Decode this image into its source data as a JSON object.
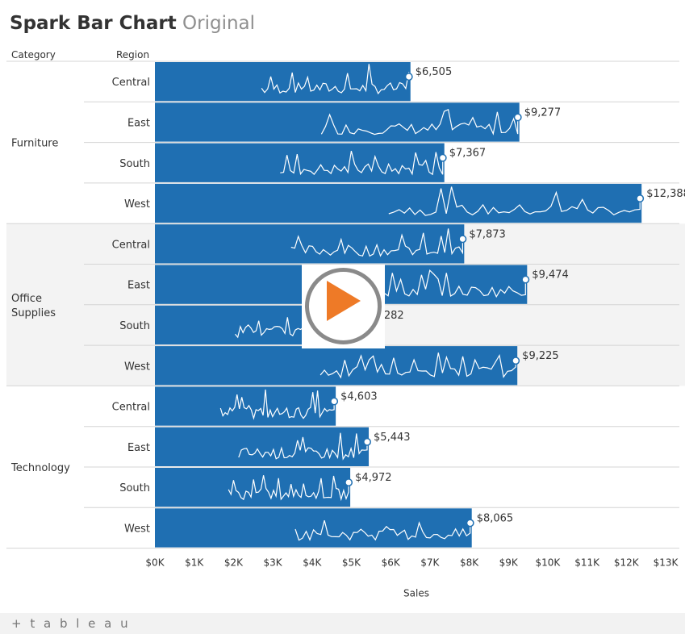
{
  "title": {
    "main": "Spark Bar Chart",
    "sub": "Original"
  },
  "headers": {
    "category": "Category",
    "region": "Region"
  },
  "footer": {
    "logo_text": "+ t a b l e a u"
  },
  "colors": {
    "bar": "#1f6fb2",
    "line": "#ffffff",
    "band": "#f3f3f3",
    "grid": "#d4d4d4"
  },
  "chart_data": {
    "type": "bar",
    "xlabel": "Sales",
    "ylabel": "",
    "xlim": [
      0,
      13000
    ],
    "x_ticks": [
      "$0K",
      "$1K",
      "$2K",
      "$3K",
      "$4K",
      "$5K",
      "$6K",
      "$7K",
      "$8K",
      "$9K",
      "$10K",
      "$11K",
      "$12K",
      "$13K"
    ],
    "categories": [
      {
        "name": "Furniture",
        "rows": [
          {
            "region": "Central",
            "value": 6505,
            "label": "$6,505"
          },
          {
            "region": "East",
            "value": 9277,
            "label": "$9,277"
          },
          {
            "region": "South",
            "value": 7367,
            "label": "$7,367"
          },
          {
            "region": "West",
            "value": 12388,
            "label": "$12,388"
          }
        ]
      },
      {
        "name": "Office Supplies",
        "rows": [
          {
            "region": "Central",
            "value": 7873,
            "label": "$7,873"
          },
          {
            "region": "East",
            "value": 9474,
            "label": "$9,474"
          },
          {
            "region": "South",
            "value": 5282,
            "label": "$5,282"
          },
          {
            "region": "West",
            "value": 9225,
            "label": "$9,225"
          }
        ]
      },
      {
        "name": "Technology",
        "rows": [
          {
            "region": "Central",
            "value": 4603,
            "label": "$4,603"
          },
          {
            "region": "East",
            "value": 5443,
            "label": "$5,443"
          },
          {
            "region": "South",
            "value": 4972,
            "label": "$4,972"
          },
          {
            "region": "West",
            "value": 8065,
            "label": "$8,065"
          }
        ]
      }
    ],
    "grid": false,
    "legend": "none"
  }
}
